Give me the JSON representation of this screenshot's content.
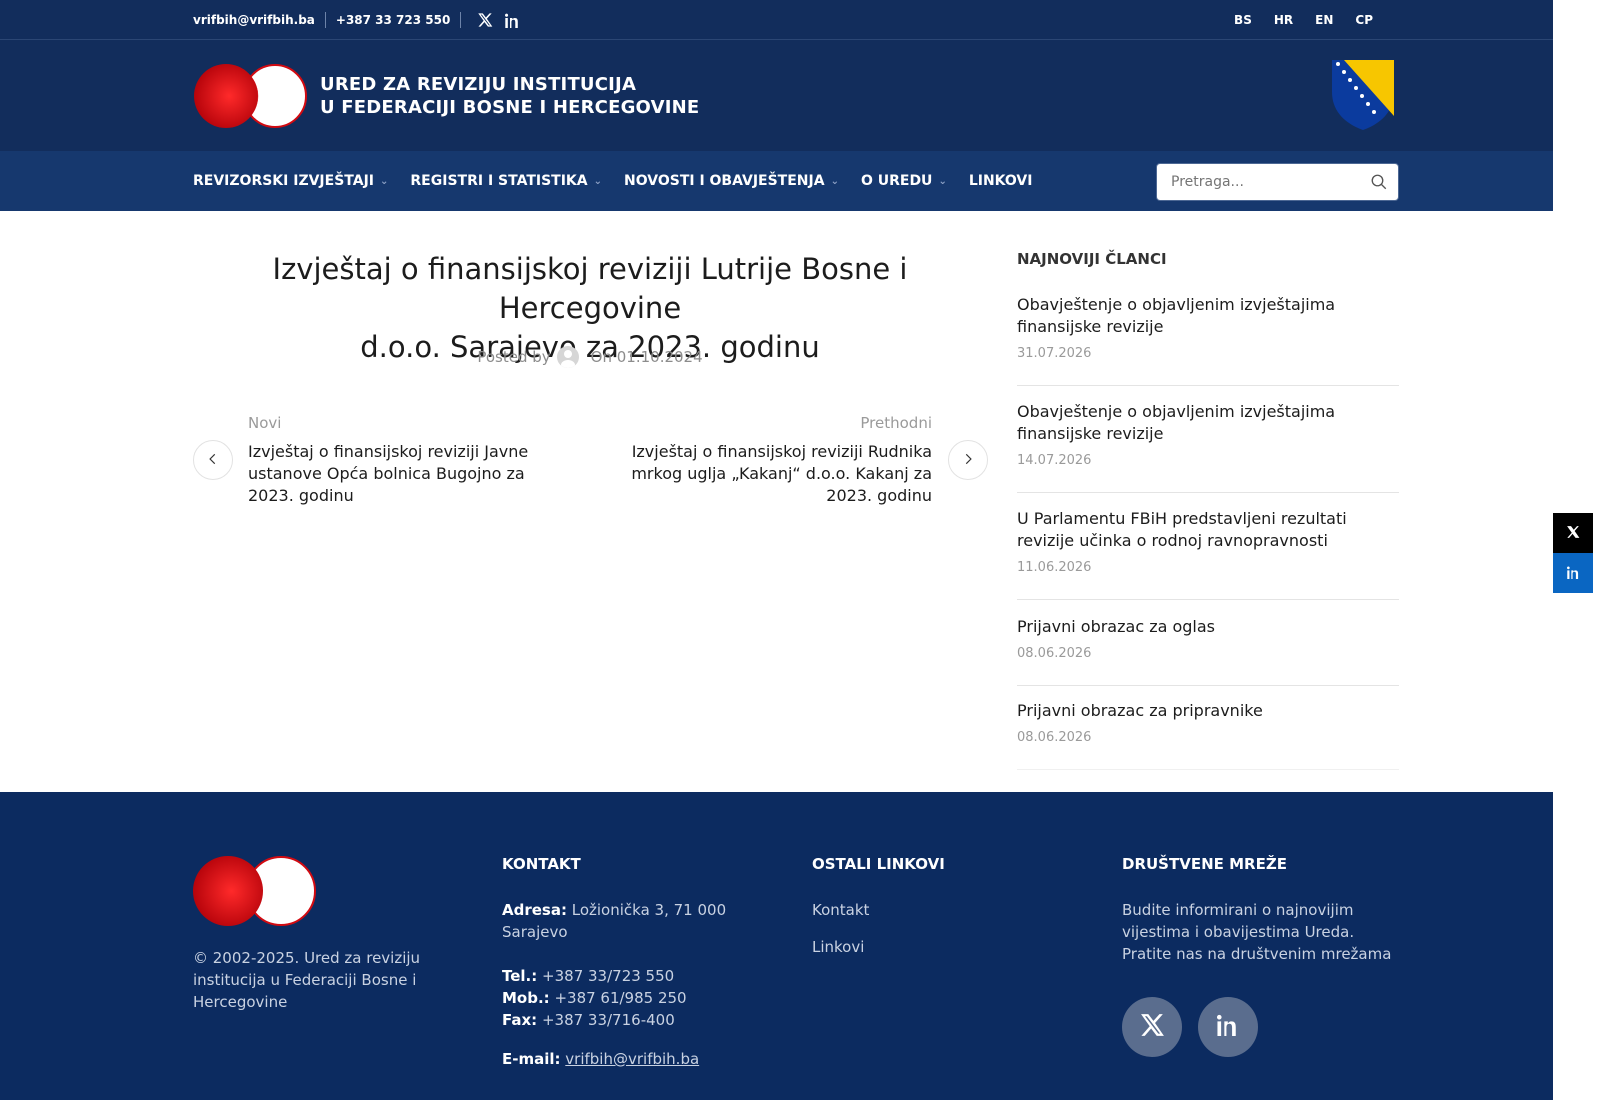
{
  "topbar": {
    "email": "vrifbih@vrifbih.ba",
    "phone": "+387 33 723 550",
    "social_icons": [
      "x-icon",
      "linkedin-icon"
    ],
    "languages": [
      "BS",
      "HR",
      "EN",
      "CP"
    ]
  },
  "header": {
    "logo_line1": "URED ZA REVIZIJU INSTITUCIJA",
    "logo_line2": "U FEDERACIJI BOSNE I HERCEGOVINE"
  },
  "nav": {
    "items": [
      {
        "label": "REVIZORSKI IZVJEŠTAJI",
        "has_dropdown": true
      },
      {
        "label": "REGISTRI I STATISTIKA",
        "has_dropdown": true
      },
      {
        "label": "NOVOSTI I OBAVJEŠTENJA",
        "has_dropdown": true
      },
      {
        "label": "O UREDU",
        "has_dropdown": true
      },
      {
        "label": "LINKOVI",
        "has_dropdown": false
      }
    ],
    "search_placeholder": "Pretraga..."
  },
  "article": {
    "title_line1": "Izvještaj o finansijskoj reviziji Lutrije Bosne i Hercegovine",
    "title_line2": "d.o.o. Sarajevo za 2023. godinu",
    "posted_by": "Posted by",
    "on_date": "On 01.10.2024"
  },
  "post_nav": {
    "newer_label": "Novi",
    "newer_title": "Izvještaj o finansijskoj reviziji Javne ustanove Opća bolnica Bugojno za 2023. godinu",
    "older_label": "Prethodni",
    "older_title": "Izvještaj o finansijskoj reviziji Rudnika mrkog uglja „Kakanj“ d.o.o. Kakanj za 2023. godinu"
  },
  "sidebar": {
    "heading": "NAJNOVIJI ČLANCI",
    "items": [
      {
        "title": "Obavještenje o objavljenim izvještajima finansijske revizije",
        "date": "31.07.2026"
      },
      {
        "title": "Obavještenje o objavljenim izvještajima finansijske revizije",
        "date": "14.07.2026"
      },
      {
        "title": "U Parlamentu FBiH predstavljeni rezultati revizije učinka o rodnoj ravnopravnosti",
        "date": "11.06.2026"
      },
      {
        "title": "Prijavni obrazac za oglas",
        "date": "08.06.2026"
      },
      {
        "title": "Prijavni obrazac za pripravnike",
        "date": "08.06.2026"
      }
    ]
  },
  "footer": {
    "copyright": "© 2002-2025. Ured za reviziju institucija u Federaciji Bosne i Hercegovine",
    "kontakt_heading": "KONTAKT",
    "adresa_label": "Adresa:",
    "adresa_value": "Ložionička 3, 71 000 Sarajevo",
    "tel_label": "Tel.:",
    "tel_value": "+387 33/723 550",
    "mob_label": "Mob.:",
    "mob_value": "+387 61/985 250",
    "fax_label": "Fax:",
    "fax_value": "+387 33/716-400",
    "email_label": "E-mail:",
    "email_value": "vrifbih@vrifbih.ba",
    "links_heading": "OSTALI LINKOVI",
    "links": [
      "Kontakt",
      "Linkovi"
    ],
    "social_heading": "DRUŠTVENE MREŽE",
    "social_text": "Budite informirani o najnovijim vijestima i obavijestima Ureda. Pratite nas na društvenim mrežama"
  },
  "colors": {
    "header_bg": "#122d5c",
    "nav_bg": "#16386e",
    "footer_bg": "#0c2b60",
    "accent_red": "#d20a11",
    "linkedin_blue": "#0a66c2"
  }
}
